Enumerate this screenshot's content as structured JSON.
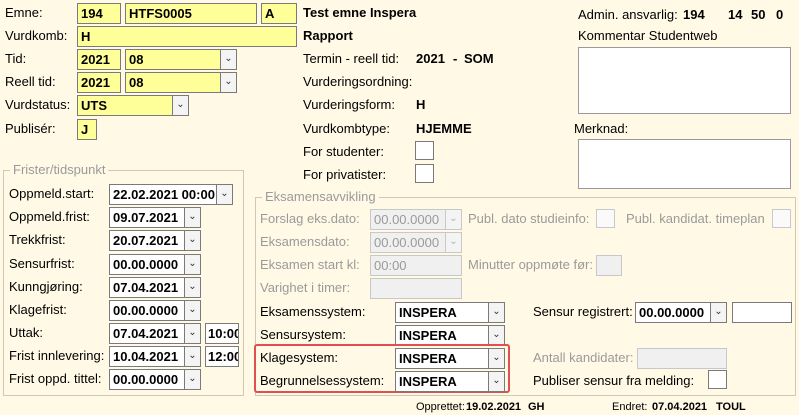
{
  "labels": {
    "emne": "Emne:",
    "vurdkomb": "Vurdkomb:",
    "tid": "Tid:",
    "reell_tid": "Reell tid:",
    "vurdstatus": "Vurdstatus:",
    "publiser": "Publisér:",
    "termin_reell": "Termin - reell tid:",
    "vurderingsordning": "Vurderingsordning:",
    "vurderingsform": "Vurderingsform:",
    "vurdkombtype": "Vurdkombtype:",
    "for_studenter": "For studenter:",
    "for_privatister": "For privatister:",
    "admin_ansvarlig": "Admin. ansvarlig:",
    "kommentar_studentweb": "Kommentar Studentweb",
    "merknad": "Merknad:"
  },
  "values": {
    "emne_kode": "194",
    "emne_id": "HTFS0005",
    "emne_versjon": "A",
    "emne_navn": "Test emne Inspera",
    "vurdkomb": "H",
    "vurdkomb_navn": "Rapport",
    "tid_aar": "2021",
    "tid_termin": "08",
    "reell_aar": "2021",
    "reell_termin": "08",
    "vurdstatus": "UTS",
    "publiser": "J",
    "termin_reell_aar": "2021",
    "termin_reell_sep": "-",
    "termin_reell_kode": "SOM",
    "vurderingsform": "H",
    "vurdkombtype": "HJEMME",
    "admin_ansvarlig_kode": "194",
    "admin_ansvarlig_a": "14",
    "admin_ansvarlig_b": "50",
    "admin_ansvarlig_c": "0"
  },
  "frister": {
    "title": "Frister/tidspunkt",
    "rows": [
      {
        "label": "Oppmeld.start:",
        "value": "22.02.2021 00:00"
      },
      {
        "label": "Oppmeld.frist:",
        "value": "09.07.2021"
      },
      {
        "label": "Trekkfrist:",
        "value": "20.07.2021"
      },
      {
        "label": "Sensurfrist:",
        "value": "00.00.0000"
      },
      {
        "label": "Kunngjøring:",
        "value": "07.04.2021"
      },
      {
        "label": "Klagefrist:",
        "value": "00.00.0000"
      },
      {
        "label": "Uttak:",
        "value": "07.04.2021",
        "time": "10:00"
      },
      {
        "label": "Frist innlevering:",
        "value": "10.04.2021",
        "time": "12:00"
      },
      {
        "label": "Frist oppd. tittel:",
        "value": "00.00.0000"
      }
    ]
  },
  "eksamen": {
    "title": "Eksamensavvikling",
    "forslag_label": "Forslag eks.dato:",
    "forslag_value": "00.00.0000",
    "publ_dato_label": "Publ. dato studieinfo:",
    "publ_kandidat_label": "Publ. kandidat. timeplan",
    "eksamensdato_label": "Eksamensdato:",
    "eksamensdato_value": "00.00.0000",
    "start_kl_label": "Eksamen start kl:",
    "start_kl_value": "00:00",
    "minutter_label": "Minutter oppmøte før:",
    "varighet_label": "Varighet i timer:",
    "eksamenssystem_label": "Eksamenssystem:",
    "eksamenssystem_value": "INSPERA",
    "sensursystem_label": "Sensursystem:",
    "sensursystem_value": "INSPERA",
    "klagesystem_label": "Klagesystem:",
    "klagesystem_value": "INSPERA",
    "begrunnelse_label": "Begrunnelsessystem:",
    "begrunnelse_value": "INSPERA",
    "sensur_reg_label": "Sensur registrert:",
    "sensur_reg_value": "00.00.0000",
    "antall_label": "Antall kandidater:",
    "publiser_sensur_label": "Publiser sensur fra melding:"
  },
  "footer": {
    "opprettet_label": "Opprettet:",
    "opprettet_date": "19.02.2021",
    "opprettet_user": "GH",
    "endret_label": "Endret:",
    "endret_date": "07.04.2021",
    "endret_user": "TOUL"
  },
  "icons": {
    "dropdown": "chevron-down-icon"
  },
  "colors": {
    "background": "#fff9e6",
    "required_field": "#ffff99",
    "highlight_box": "#e05050"
  }
}
